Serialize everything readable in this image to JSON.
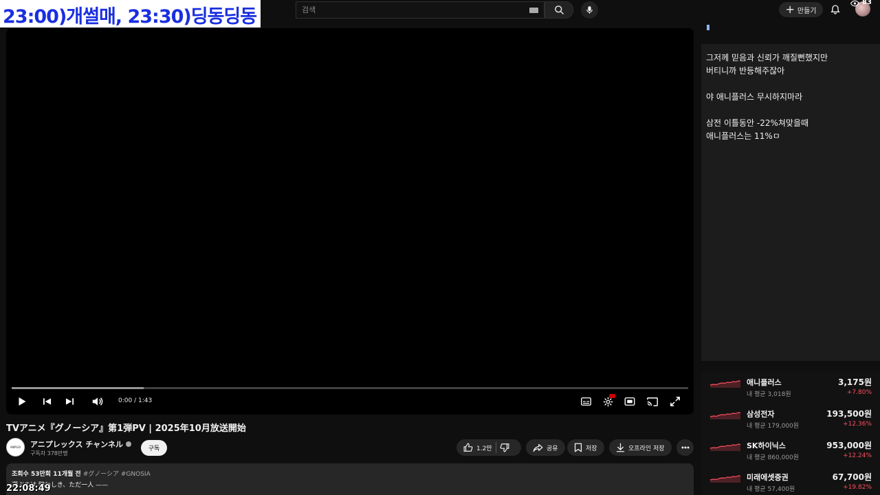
{
  "overlay_title": "23:00)개썰매, 23:30)딩동딩동",
  "search": {
    "placeholder": "검색"
  },
  "header": {
    "create_label": "만들기",
    "viewer_count": "83"
  },
  "player": {
    "time": "0:00 / 1:43",
    "progress_loaded": 0.195
  },
  "video": {
    "title": "TVアニメ『グノーシア』第1弾PV | 2025年10月放送開始",
    "channel_name": "アニプレックス チャンネル",
    "subscribers": "구독자 378만명",
    "channel_avatar_text": "ANIPLEX",
    "subscribe_label": "구독",
    "like_count": "1.2만",
    "share_label": "공유",
    "save_label": "저장",
    "offline_label": "오프라인 저장"
  },
  "description": {
    "stats": "조회수 53만회  11개월 전",
    "tags": "#グノーシア #GNOSIA",
    "line2": "選ぶのは 騙わしき、ただ一人 ——"
  },
  "clock": "22:08:49",
  "chat": {
    "lines": [
      "그저께 믿음과 신뢰가 깨질뻔했지만",
      "버티니까 반등해주잖아",
      "",
      "야 애니플러스 무시하지마라",
      "",
      "삼전 이틀동안 -22%쳐맞을때",
      "애니플러스는 11%ㅁ"
    ]
  },
  "stocks": [
    {
      "name": "애니플러스",
      "avg": "내 평균 3,018원",
      "price": "3,175원",
      "change": "+7.80%"
    },
    {
      "name": "삼성전자",
      "avg": "내 평균 179,000원",
      "price": "193,500원",
      "change": "+12.36%"
    },
    {
      "name": "SK하이닉스",
      "avg": "내 평균 860,000원",
      "price": "953,000원",
      "change": "+12.24%"
    },
    {
      "name": "미래에셋증권",
      "avg": "내 평균 57,400원",
      "price": "67,700원",
      "change": "+19.82%"
    }
  ],
  "colors": {
    "accent_red": "#ff4d5e",
    "overlay_blue": "#1a2fe0",
    "background": "#0f0f0f"
  },
  "icons": [
    "search-icon",
    "mic-icon",
    "keyboard-icon",
    "plus-icon",
    "bell-icon",
    "eye-icon",
    "play-icon",
    "previous-icon",
    "next-icon",
    "volume-icon",
    "captions-icon",
    "settings-icon",
    "theater-icon",
    "cast-icon",
    "fullscreen-icon",
    "like-icon",
    "dislike-icon",
    "share-icon",
    "save-icon",
    "download-icon",
    "more-icon"
  ]
}
